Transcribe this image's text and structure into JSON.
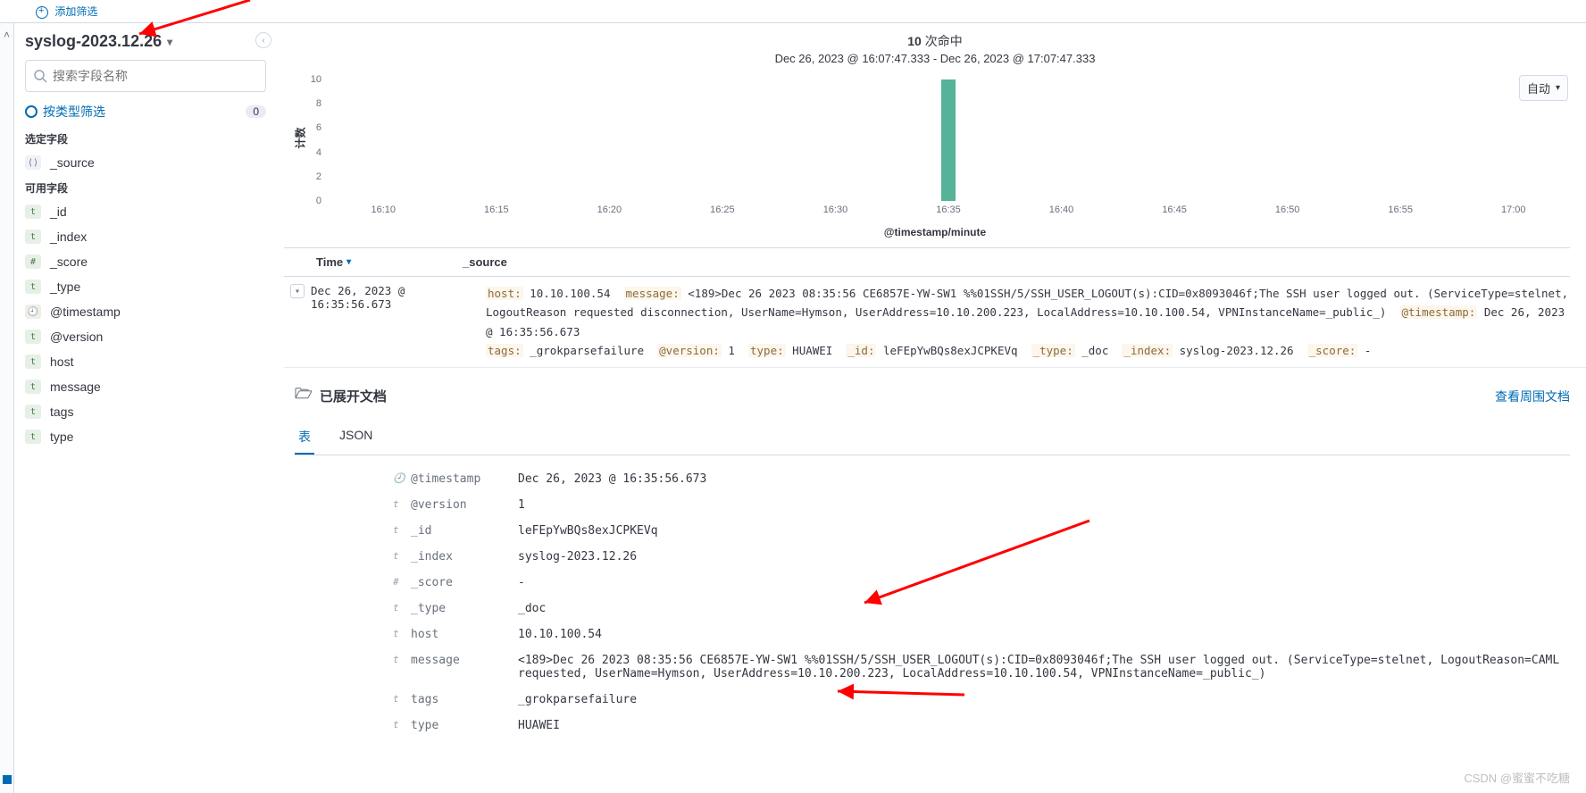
{
  "topbar": {
    "add_filter": "添加筛选"
  },
  "sidebar": {
    "index_pattern": "syslog-2023.12.26",
    "search_placeholder": "搜索字段名称",
    "filter_by_type": "按类型筛选",
    "filter_count": "0",
    "selected_label": "选定字段",
    "available_label": "可用字段",
    "selected_fields": [
      {
        "type": "src",
        "name": "_source"
      }
    ],
    "available_fields": [
      {
        "type": "t",
        "name": "_id"
      },
      {
        "type": "t",
        "name": "_index"
      },
      {
        "type": "#",
        "name": "_score"
      },
      {
        "type": "t",
        "name": "_type"
      },
      {
        "type": "clock",
        "name": "@timestamp"
      },
      {
        "type": "t",
        "name": "@version"
      },
      {
        "type": "t",
        "name": "host"
      },
      {
        "type": "t",
        "name": "message"
      },
      {
        "type": "t",
        "name": "tags"
      },
      {
        "type": "t",
        "name": "type"
      }
    ]
  },
  "chart_data": {
    "type": "bar",
    "title_count": "10",
    "title_suffix": " 次命中",
    "time_range": "Dec 26, 2023 @ 16:07:47.333 - Dec 26, 2023 @ 17:07:47.333",
    "interval": "自动",
    "ylabel": "计数",
    "xlabel": "@timestamp/minute",
    "y_ticks": [
      0,
      2,
      4,
      6,
      8,
      10
    ],
    "x_ticks": [
      "16:10",
      "16:15",
      "16:20",
      "16:25",
      "16:30",
      "16:35",
      "16:40",
      "16:45",
      "16:50",
      "16:55",
      "17:00"
    ],
    "categories": [
      "16:35"
    ],
    "values": [
      10
    ],
    "bar_index": 5
  },
  "columns": {
    "time": "Time",
    "source": "_source"
  },
  "row": {
    "timestamp": "Dec 26, 2023 @ 16:35:56.673",
    "kv": {
      "host_k": "host:",
      "host_v": "10.10.100.54",
      "message_k": "message:",
      "message_v": "<189>Dec 26 2023 08:35:56 CE6857E-YW-SW1 %%01SSH/5/SSH_USER_LOGOUT(s):CID=0x8093046f;The SSH user logged out. (ServiceType=stelnet, LogoutReason requested disconnection, UserName=Hymson, UserAddress=10.10.200.223, LocalAddress=10.10.100.54, VPNInstanceName=_public_)",
      "ts_k": "@timestamp:",
      "ts_v": "Dec 26, 2023 @ 16:35:56.673",
      "tags_k": "tags:",
      "tags_v": "_grokparsefailure",
      "ver_k": "@version:",
      "ver_v": "1",
      "type_k": "type:",
      "type_v": "HUAWEI",
      "id_k": "_id:",
      "id_v": "leFEpYwBQs8exJCPKEVq",
      "ltype_k": "_type:",
      "ltype_v": "_doc",
      "idx_k": "_index:",
      "idx_v": "syslog-2023.12.26",
      "score_k": "_score:",
      "score_v": "-"
    }
  },
  "detail": {
    "title": "已展开文档",
    "surrounding_link": "查看周围文档",
    "tabs": {
      "table": "表",
      "json": "JSON"
    },
    "fields": [
      {
        "icon": "🕘",
        "name": "@timestamp",
        "value": "Dec 26, 2023 @ 16:35:56.673"
      },
      {
        "icon": "t",
        "name": "@version",
        "value": "1"
      },
      {
        "icon": "t",
        "name": "_id",
        "value": "leFEpYwBQs8exJCPKEVq"
      },
      {
        "icon": "t",
        "name": "_index",
        "value": "syslog-2023.12.26"
      },
      {
        "icon": "#",
        "name": "_score",
        "value": "-"
      },
      {
        "icon": "t",
        "name": "_type",
        "value": "_doc"
      },
      {
        "icon": "t",
        "name": "host",
        "value": "10.10.100.54"
      },
      {
        "icon": "t",
        "name": "message",
        "value": "<189>Dec 26 2023 08:35:56 CE6857E-YW-SW1 %%01SSH/5/SSH_USER_LOGOUT(s):CID=0x8093046f;The SSH user logged out. (ServiceType=stelnet, LogoutReason=CAML requested, UserName=Hymson, UserAddress=10.10.200.223, LocalAddress=10.10.100.54, VPNInstanceName=_public_)"
      },
      {
        "icon": "t",
        "name": "tags",
        "value": "_grokparsefailure"
      },
      {
        "icon": "t",
        "name": "type",
        "value": "HUAWEI"
      }
    ]
  },
  "watermark": "CSDN @蜜蜜不吃糖"
}
